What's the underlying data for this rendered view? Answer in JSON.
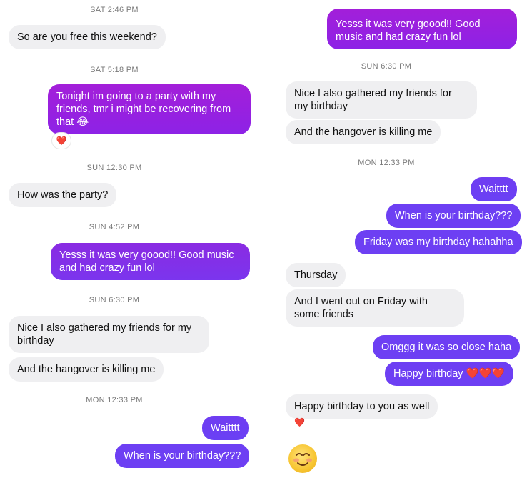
{
  "left": {
    "items": [
      {
        "kind": "ts",
        "text": "SAT 2:46 PM"
      },
      {
        "kind": "in",
        "text": "So are you free this weekend?"
      },
      {
        "kind": "ts",
        "text": "SAT 5:18 PM"
      },
      {
        "kind": "out",
        "text": "Tonight im going to a party with my friends, tmr i might be recovering from that 😂",
        "reaction": "❤️"
      },
      {
        "kind": "ts",
        "text": "SUN 12:30 PM"
      },
      {
        "kind": "in",
        "text": "How was the party?"
      },
      {
        "kind": "ts",
        "text": "SUN 4:52 PM"
      },
      {
        "kind": "out",
        "text": "Yesss it was very goood!! Good music and had crazy fun lol"
      },
      {
        "kind": "ts",
        "text": "SUN 6:30 PM"
      },
      {
        "kind": "in",
        "text": "Nice I also gathered my friends for my birthday"
      },
      {
        "kind": "in",
        "text": "And the hangover is killing me"
      },
      {
        "kind": "ts",
        "text": "MON 12:33 PM"
      },
      {
        "kind": "out",
        "text": "Waitttt"
      },
      {
        "kind": "out",
        "text": "When is your birthday???"
      }
    ]
  },
  "right": {
    "items": [
      {
        "kind": "out",
        "text": "Yesss it was very goood!! Good music and had crazy fun lol"
      },
      {
        "kind": "ts",
        "text": "SUN 6:30 PM"
      },
      {
        "kind": "in",
        "text": "Nice I also gathered my friends for my birthday"
      },
      {
        "kind": "in",
        "text": "And the hangover is killing me"
      },
      {
        "kind": "ts",
        "text": "MON 12:33 PM"
      },
      {
        "kind": "out",
        "text": "Waitttt"
      },
      {
        "kind": "out",
        "text": "When is your birthday???"
      },
      {
        "kind": "out",
        "text": "Friday was my birthday hahahha"
      },
      {
        "kind": "in",
        "text": "Thursday"
      },
      {
        "kind": "in",
        "text": "And I went out on Friday with some friends"
      },
      {
        "kind": "out",
        "text": "Omggg it was so close haha"
      },
      {
        "kind": "out",
        "text": "Happy birthday ❤️❤️❤️"
      },
      {
        "kind": "in",
        "text": "Happy birthday to you as well",
        "reaction": "❤️"
      },
      {
        "kind": "emoji",
        "text": "☺️",
        "icon": "smiling-face-icon"
      }
    ]
  }
}
